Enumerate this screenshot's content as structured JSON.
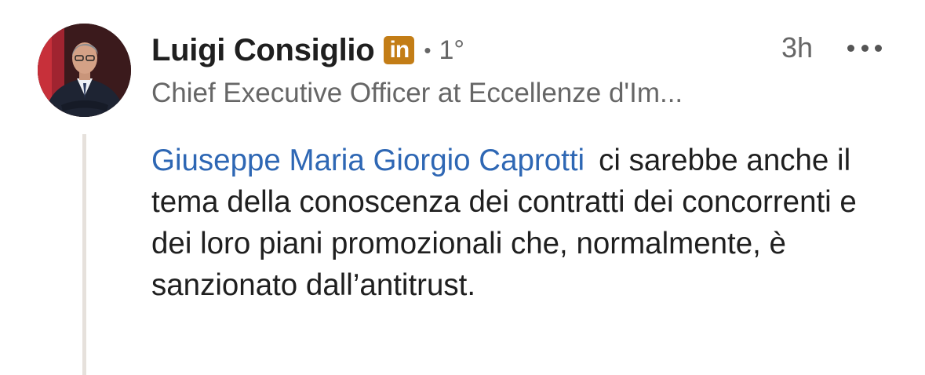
{
  "comment": {
    "author": {
      "name": "Luigi Consiglio",
      "badge_text": "in",
      "separator": "•",
      "degree": "1°",
      "headline": "Chief Executive Officer at Eccellenze d'Im..."
    },
    "timestamp": "3h",
    "mention": "Giuseppe Maria Giorgio Caprotti",
    "text": "ci sarebbe anche il tema della conoscenza dei contratti dei concorrenti e dei loro piani promozionali che, normalmente, è sanzionato dall’antitrust."
  },
  "colors": {
    "mention": "#2e67b4",
    "badge": "#c37d16",
    "secondary_text": "#666666",
    "thread_line": "#e6e1dc"
  },
  "icons": {
    "badge": "linkedin-icon",
    "more": "more-options-icon"
  }
}
